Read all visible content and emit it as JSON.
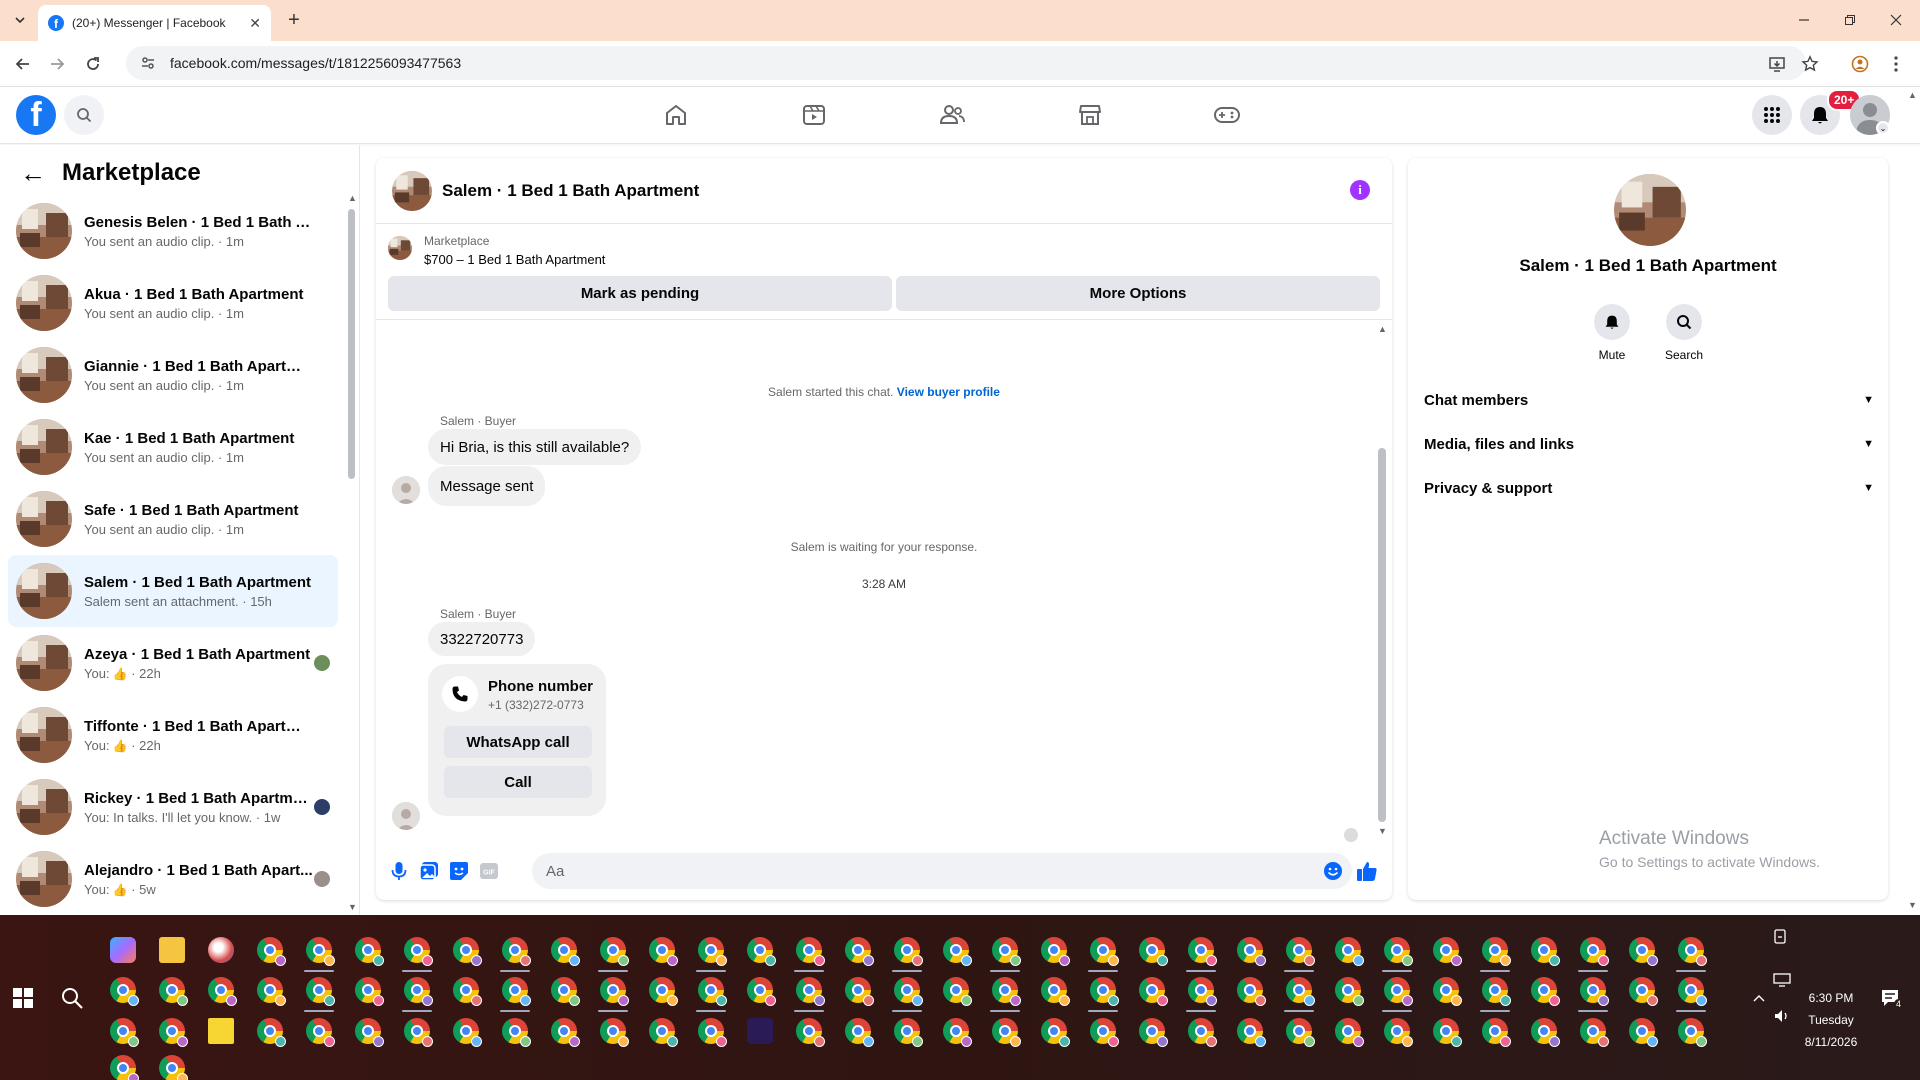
{
  "browser": {
    "tab_title": "(20+) Messenger | Facebook",
    "url": "facebook.com/messages/t/1812256093477563"
  },
  "topbar": {
    "notifications_badge": "20+",
    "nav_icons": [
      "home-icon",
      "video-icon",
      "friends-icon",
      "marketplace-icon",
      "gaming-icon"
    ]
  },
  "sidebar": {
    "title": "Marketplace",
    "conversations": [
      {
        "name": "Genesis Belen · 1 Bed 1 Bath Apa...",
        "preview": "You sent an audio clip. · 1m",
        "active": false
      },
      {
        "name": "Akua · 1 Bed 1 Bath Apartment",
        "preview": "You sent an audio clip. · 1m",
        "active": false
      },
      {
        "name": "Giannie · 1 Bed 1 Bath Apartment",
        "preview": "You sent an audio clip. · 1m",
        "active": false
      },
      {
        "name": "Kae · 1 Bed 1 Bath Apartment",
        "preview": "You sent an audio clip. · 1m",
        "active": false
      },
      {
        "name": "Safe · 1 Bed 1 Bath Apartment",
        "preview": "You sent an audio clip. · 1m",
        "active": false
      },
      {
        "name": "Salem · 1 Bed 1 Bath Apartment",
        "preview": "Salem sent an attachment. · 15h",
        "active": true
      },
      {
        "name": "Azeya · 1 Bed 1 Bath Apartment",
        "preview_prefix": "You:",
        "preview": "· 22h",
        "active": false
      },
      {
        "name": "Tiffonte · 1 Bed 1 Bath Apartment",
        "preview_prefix": "You:",
        "preview": "· 22h",
        "active": false
      },
      {
        "name": "Rickey · 1 Bed 1 Bath Apartment",
        "preview": "You: In talks. I'll let you know. · 1w",
        "active": false
      },
      {
        "name": "Alejandro · 1 Bed 1 Bath Apart...",
        "preview_prefix": "You:",
        "preview": "· 5w",
        "active": false
      }
    ]
  },
  "chat": {
    "title": "Salem · 1 Bed 1 Bath Apartment",
    "listing": {
      "source": "Marketplace",
      "title": "$700 – 1 Bed 1 Bath Apartment",
      "pending_button": "Mark as pending",
      "options_button": "More Options"
    },
    "started_text": "Salem started this chat.",
    "buyer_profile_link": "View buyer profile",
    "sender_label_1": "Salem · Buyer",
    "message_1": "Hi Bria, is this still available?",
    "message_2": "Message sent",
    "waiting_text": "Salem is waiting for your response.",
    "timestamp": "3:28 AM",
    "sender_label_2": "Salem · Buyer",
    "message_3": "3322720773",
    "phone_card": {
      "title": "Phone number",
      "number": "+1 (332)272-0773",
      "whatsapp_button": "WhatsApp call",
      "call_button": "Call"
    },
    "composer_placeholder": "Aa"
  },
  "info_panel": {
    "name": "Salem · 1 Bed 1 Bath Apartment",
    "mute_label": "Mute",
    "search_label": "Search",
    "sections": [
      "Chat members",
      "Media, files and links",
      "Privacy & support"
    ]
  },
  "watermark": {
    "line1": "Activate Windows",
    "line2": "Go to Settings to activate Windows."
  },
  "taskbar": {
    "time": "6:30 PM",
    "day": "Tuesday",
    "date": "8/11/2026",
    "notification_count": "4"
  },
  "colors": {
    "facebook_blue": "#1877f2",
    "active_conversation": "#ebf5ff",
    "info_purple": "#a033ff",
    "badge_red": "#e41e3f"
  }
}
